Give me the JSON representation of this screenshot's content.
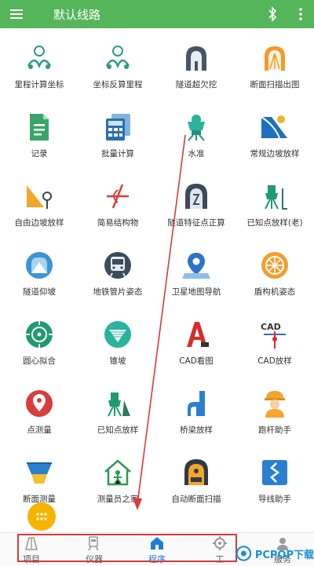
{
  "appbar": {
    "title": "默认线路",
    "menu_icon": "menu-icon",
    "bluetooth_icon": "bluetooth-icon",
    "more_icon": "more-vert-icon",
    "color": "#55b55a"
  },
  "grid": {
    "items": [
      {
        "label": "里程计算坐标",
        "icon": "mileage-to-coords-icon"
      },
      {
        "label": "坐标反算里程",
        "icon": "coords-to-mileage-icon"
      },
      {
        "label": "隧道超欠挖",
        "icon": "tunnel-overbreak-icon"
      },
      {
        "label": "断面扫描出图",
        "icon": "section-scan-icon"
      },
      {
        "label": "记录",
        "icon": "record-icon"
      },
      {
        "label": "批量计算",
        "icon": "batch-calc-icon"
      },
      {
        "label": "水准",
        "icon": "leveling-icon"
      },
      {
        "label": "常规边坡放样",
        "icon": "slope-stakeout-icon"
      },
      {
        "label": "自由边坡放样",
        "icon": "free-slope-icon"
      },
      {
        "label": "简易结构物",
        "icon": "simple-structure-icon"
      },
      {
        "label": "隧道特征点正算",
        "icon": "tunnel-feature-icon"
      },
      {
        "label": "已知点放样(老)",
        "icon": "known-point-old-icon"
      },
      {
        "label": "隧道仰坡",
        "icon": "tunnel-slope-icon"
      },
      {
        "label": "地铁管片姿态",
        "icon": "metro-segment-icon"
      },
      {
        "label": "卫星地图导航",
        "icon": "satellite-nav-icon"
      },
      {
        "label": "盾构机姿态",
        "icon": "shield-machine-icon"
      },
      {
        "label": "圆心拟合",
        "icon": "circle-fit-icon"
      },
      {
        "label": "锥坡",
        "icon": "cone-slope-icon"
      },
      {
        "label": "CAD看图",
        "icon": "cad-viewer-icon"
      },
      {
        "label": "CAD放样",
        "icon": "cad-stakeout-icon"
      },
      {
        "label": "点测量",
        "icon": "point-measure-icon"
      },
      {
        "label": "已知点放样",
        "icon": "known-point-icon"
      },
      {
        "label": "桥梁放样",
        "icon": "bridge-stakeout-icon"
      },
      {
        "label": "跑杆助手",
        "icon": "rod-assistant-icon"
      },
      {
        "label": "断面测量",
        "icon": "section-measure-icon"
      },
      {
        "label": "测量员之家",
        "icon": "surveyor-home-icon"
      },
      {
        "label": "自动断面扫描",
        "icon": "auto-section-scan-icon"
      },
      {
        "label": "导线助手",
        "icon": "traverse-assistant-icon"
      }
    ]
  },
  "fab": {
    "icon": "apps-grid-icon"
  },
  "bottom_nav": {
    "tabs": [
      {
        "label": "项目",
        "icon": "project-icon"
      },
      {
        "label": "仪器",
        "icon": "instrument-icon"
      },
      {
        "label": "程序",
        "icon": "program-icon",
        "active": true
      },
      {
        "label": "工",
        "icon": "tools-icon"
      },
      {
        "label": "服务",
        "icon": "service-icon"
      }
    ]
  },
  "watermark": {
    "text": "PCPOP下载"
  }
}
